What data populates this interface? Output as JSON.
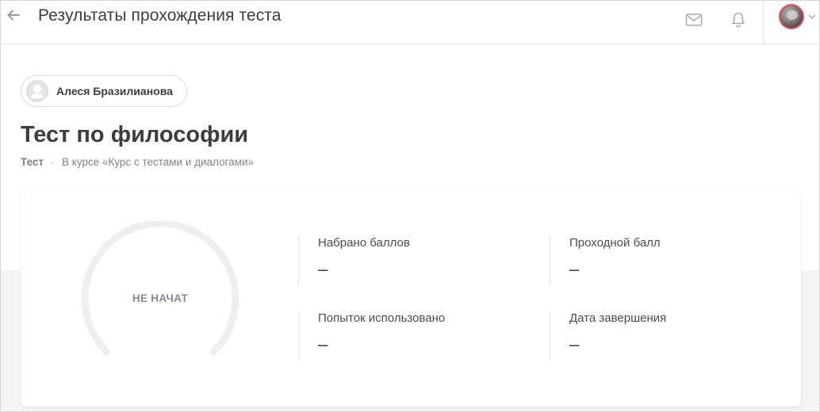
{
  "header": {
    "title": "Результаты прохождения теста",
    "icons": [
      "arrow-left-icon",
      "mail-icon",
      "bell-icon",
      "chevron-down-icon"
    ]
  },
  "student": {
    "name": "Алеся Бразилианова"
  },
  "test": {
    "title": "Тест по философии",
    "type": "Тест",
    "separator": "·",
    "course": "В курсе «Курс с тестами и диалогами»"
  },
  "result": {
    "status": "НЕ НАЧАТ",
    "progress": 0,
    "stats": [
      {
        "label": "Набрано баллов",
        "value": "–"
      },
      {
        "label": "Проходной балл",
        "value": "–"
      },
      {
        "label": "Попыток использовано",
        "value": "–"
      },
      {
        "label": "Дата завершения",
        "value": "–"
      }
    ]
  },
  "colors": {
    "text": "#3a3d42",
    "muted": "#80848b",
    "gauge_track": "#eeeff1",
    "avatar_ring": "#e0535f",
    "page_band": "#f3f4f6"
  }
}
